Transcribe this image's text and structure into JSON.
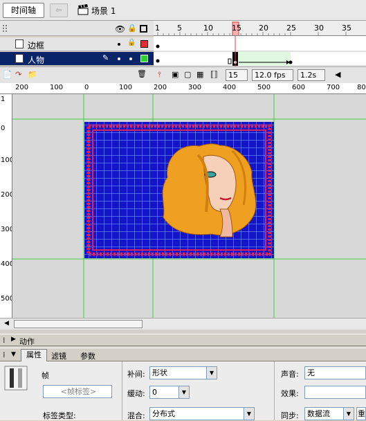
{
  "toolbar": {
    "timeline_label": "时间轴",
    "back_icon": "arrow-left-icon",
    "scene_icon": "clapperboard-icon",
    "scene_label": "场景 1"
  },
  "timeline": {
    "frame_numbers": [
      "1",
      "5",
      "10",
      "15",
      "20",
      "25",
      "30",
      "35"
    ],
    "layers": [
      {
        "name": "边框",
        "outline_color": "#e03030"
      },
      {
        "name": "人物",
        "outline_color": "#30d030"
      }
    ],
    "current_frame": "15",
    "fps": "12.0 fps",
    "time": "1.2s"
  },
  "stage": {
    "ruler_top": [
      "200",
      "100",
      "0",
      "100",
      "200",
      "300",
      "400",
      "500",
      "600",
      "700",
      "800"
    ],
    "ruler_left": [
      "1",
      "0",
      "100",
      "200",
      "300",
      "400",
      "500"
    ],
    "canvas_color": "#1010c8",
    "border_color": "#e0205a"
  },
  "panels": {
    "actions_label": "动作",
    "tabs": [
      "属性",
      "滤镜",
      "参数"
    ]
  },
  "properties": {
    "frame_label": "帧",
    "frame_name_placeholder": "<帧标签>",
    "label_type_label": "标签类型:",
    "tween_label": "补间:",
    "tween_value": "形状",
    "ease_label": "缓动:",
    "ease_value": "0",
    "blend_label": "混合:",
    "blend_value": "分布式",
    "sound_label": "声音:",
    "sound_value": "无",
    "effect_label": "效果:",
    "sync_label": "同步:",
    "sync_value": "数据流",
    "repeat_value": "重"
  }
}
